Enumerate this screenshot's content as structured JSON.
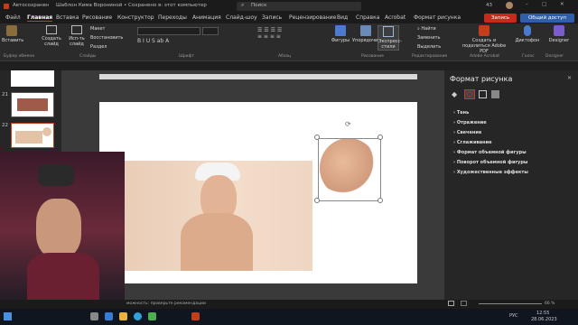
{
  "titlebar": {
    "autosave": "Автосохранение",
    "title": "Шаблон Кима Ворониной • Сохранено в: этот компьютер",
    "search": "Поиск",
    "percent": "43"
  },
  "menu": [
    "Файл",
    "Главная",
    "Вставка",
    "Рисование",
    "Конструктор",
    "Переходы",
    "Анимация",
    "Слайд-шоу",
    "Запись",
    "Рецензирование",
    "Вид",
    "Справка",
    "Acrobat",
    "Формат рисунка"
  ],
  "record_btn": "Запись",
  "share_btn": "Общий доступ",
  "ribbon": {
    "paste": "Вставить",
    "new_slide": "Создать слайд",
    "reuse": "Исп-ть слайд",
    "layout": "Макет",
    "reset": "Восстановить",
    "section": "Раздел",
    "figures": "Фигуры",
    "arrange": "Упорядочить",
    "quick_styles": "Экспресс-стили",
    "find": "Найти",
    "replace": "Заменить",
    "select": "Выделить",
    "adobe": "Создать и поделиться Adobe PDF",
    "dictate": "Диктофон",
    "designer": "Designer"
  },
  "groups": {
    "clipboard": "Буфер обмена",
    "slides": "Слайды",
    "font": "Шрифт",
    "paragraph": "Абзац",
    "drawing": "Рисование",
    "editing": "Редактирование",
    "acrobat": "Adobe Acrobat",
    "voice": "Голос",
    "designer": "Designer"
  },
  "thumbs": [
    {
      "num": "21"
    },
    {
      "num": "22"
    }
  ],
  "panel": {
    "title": "Формат рисунка",
    "items": [
      "Тень",
      "Отражение",
      "Свечение",
      "Сглаживание",
      "Формат объемной фигуры",
      "Поворот объемной фигуры",
      "Художественные эффекты"
    ]
  },
  "status": {
    "text": "можность: проверьте рекомендации",
    "zoom": "66 %"
  },
  "taskbar": {
    "lang": "РУС",
    "time": "12:55",
    "date": "28.06.2023"
  },
  "colors": {
    "accent": "#c43e1c",
    "record": "#c42b1c",
    "share": "#2f5fa8"
  }
}
